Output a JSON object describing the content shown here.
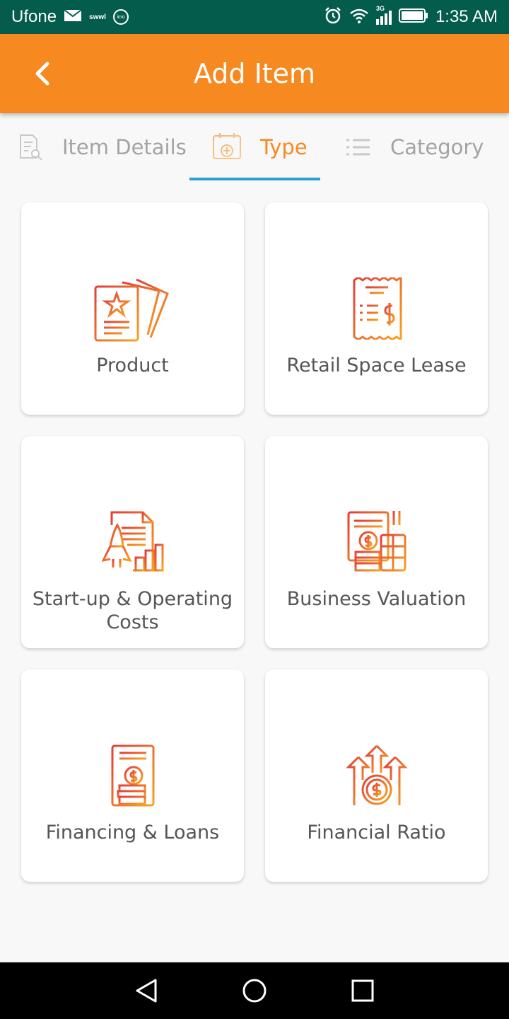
{
  "status_bar": {
    "carrier": "Ufone",
    "swwl": "swwl",
    "imo": "imo",
    "network": "3G",
    "time": "1:35 AM"
  },
  "app_bar": {
    "title": "Add Item"
  },
  "tabs": [
    {
      "label": "Item Details",
      "icon": "document-search-icon"
    },
    {
      "label": "Type",
      "icon": "calendar-add-icon"
    },
    {
      "label": "Category",
      "icon": "list-icon"
    }
  ],
  "active_tab": "Type",
  "cards": [
    {
      "label": "Product",
      "icon": "product-cards-icon"
    },
    {
      "label": "Retail Space Lease",
      "icon": "receipt-dollar-icon"
    },
    {
      "label_line1": "Start-up & Operating",
      "label_line2": "Costs",
      "icon": "rocket-document-icon"
    },
    {
      "label": "Business Valuation",
      "icon": "calculator-coins-icon"
    },
    {
      "label": "Financing & Loans",
      "icon": "document-coins-icon"
    },
    {
      "label": "Financial Ratio",
      "icon": "growth-arrows-coin-icon"
    }
  ],
  "colors": {
    "status_bar": "#045c4c",
    "accent": "#f6891f",
    "tab_indicator": "#2b9fd8",
    "icon_gradient_start": "#e8423a",
    "icon_gradient_end": "#f5a021"
  }
}
